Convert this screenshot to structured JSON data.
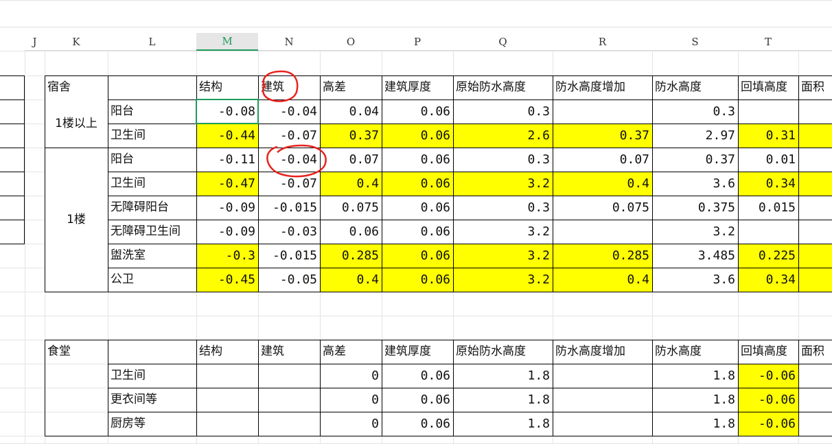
{
  "column_headers": [
    "J",
    "K",
    "L",
    "M",
    "N",
    "O",
    "P",
    "Q",
    "R",
    "S",
    "T"
  ],
  "selected_column": "M",
  "dorm_table": {
    "header": [
      "宿舍",
      "",
      "结构",
      "建筑",
      "高差",
      "建筑厚度",
      "原始防水高度",
      "防水高度增加",
      "防水高度",
      "回填高度",
      "面积"
    ],
    "groups": [
      "1楼以上",
      "1楼"
    ],
    "rows": [
      {
        "name": "阳台",
        "m": "-0.08",
        "n": "-0.04",
        "o": "0.04",
        "p": "0.06",
        "q": "0.3",
        "r": "",
        "s": "0.3",
        "t": ""
      },
      {
        "name": "卫生间",
        "m": "-0.44",
        "n": "-0.07",
        "o": "0.37",
        "p": "0.06",
        "q": "2.6",
        "r": "0.37",
        "s": "2.97",
        "t": "0.31"
      },
      {
        "name": "阳台",
        "m": "-0.11",
        "n": "-0.04",
        "o": "0.07",
        "p": "0.06",
        "q": "0.3",
        "r": "0.07",
        "s": "0.37",
        "t": "0.01"
      },
      {
        "name": "卫生间",
        "m": "-0.47",
        "n": "-0.07",
        "o": "0.4",
        "p": "0.06",
        "q": "3.2",
        "r": "0.4",
        "s": "3.6",
        "t": "0.34"
      },
      {
        "name": "无障碍阳台",
        "m": "-0.09",
        "n": "-0.015",
        "o": "0.075",
        "p": "0.06",
        "q": "0.3",
        "r": "0.075",
        "s": "0.375",
        "t": "0.015"
      },
      {
        "name": "无障碍卫生间",
        "m": "-0.09",
        "n": "-0.03",
        "o": "0.06",
        "p": "0.06",
        "q": "3.2",
        "r": "",
        "s": "3.2",
        "t": ""
      },
      {
        "name": "盥洗室",
        "m": "-0.3",
        "n": "-0.015",
        "o": "0.285",
        "p": "0.06",
        "q": "3.2",
        "r": "0.285",
        "s": "3.485",
        "t": "0.225"
      },
      {
        "name": "公卫",
        "m": "-0.45",
        "n": "-0.05",
        "o": "0.4",
        "p": "0.06",
        "q": "3.2",
        "r": "0.4",
        "s": "3.6",
        "t": "0.34"
      }
    ]
  },
  "canteen_table": {
    "header": [
      "食堂",
      "",
      "结构",
      "建筑",
      "高差",
      "建筑厚度",
      "原始防水高度",
      "防水高度增加",
      "防水高度",
      "回填高度",
      "面积"
    ],
    "rows": [
      {
        "name": "卫生间",
        "m": "",
        "n": "",
        "o": "0",
        "p": "0.06",
        "q": "1.8",
        "r": "",
        "s": "1.8",
        "t": "-0.06"
      },
      {
        "name": "更衣间等",
        "m": "",
        "n": "",
        "o": "0",
        "p": "0.06",
        "q": "1.8",
        "r": "",
        "s": "1.8",
        "t": "-0.06"
      },
      {
        "name": "厨房等",
        "m": "",
        "n": "",
        "o": "0",
        "p": "0.06",
        "q": "1.8",
        "r": "",
        "s": "1.8",
        "t": "-0.06"
      }
    ]
  },
  "colors": {
    "highlight": "#ffff00",
    "selection": "#1e9a5a",
    "annotation": "#e8211c"
  }
}
